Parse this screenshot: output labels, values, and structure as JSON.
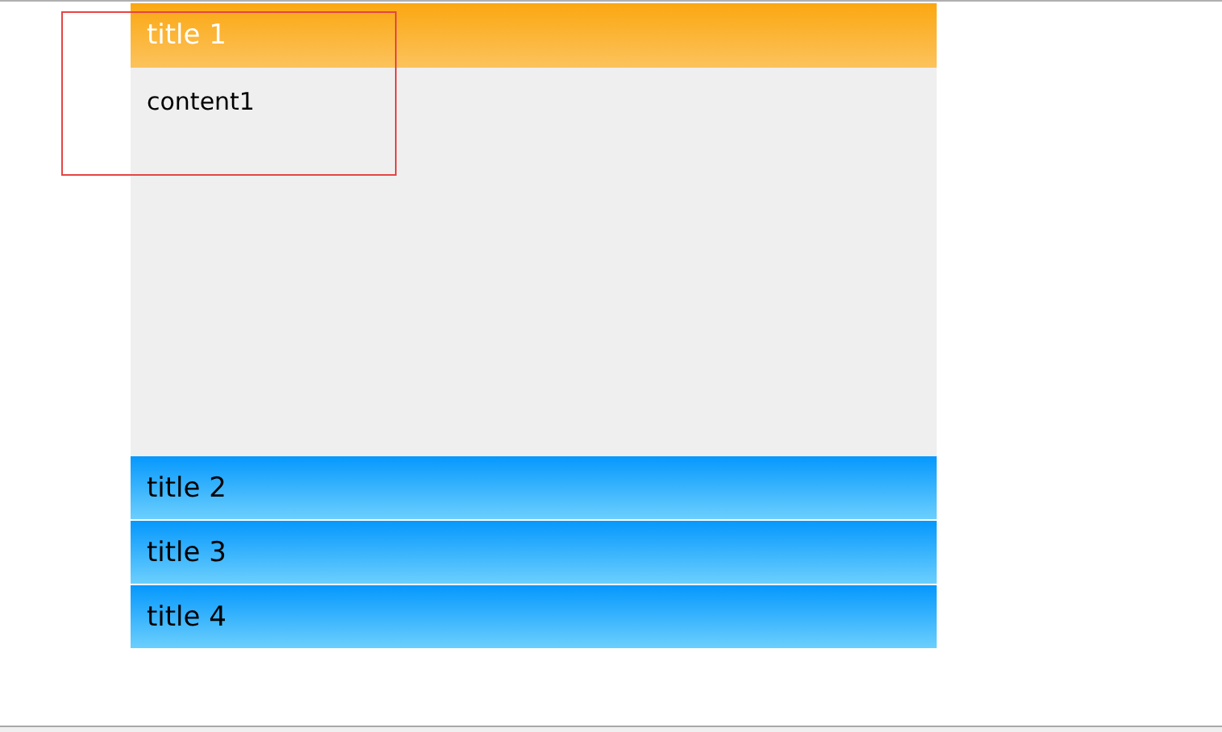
{
  "accordion": {
    "panels": [
      {
        "title": "title 1",
        "expanded": true,
        "content": "content1"
      },
      {
        "title": "title 2",
        "expanded": false
      },
      {
        "title": "title 3",
        "expanded": false
      },
      {
        "title": "title 4",
        "expanded": false
      }
    ]
  }
}
